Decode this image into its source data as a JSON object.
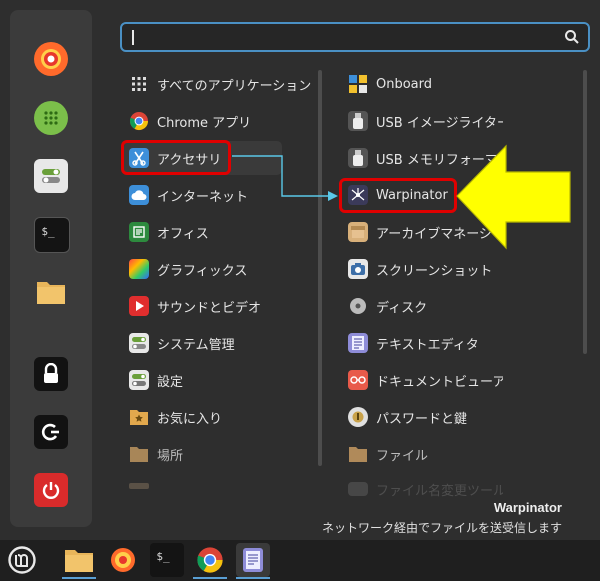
{
  "search": {
    "value": ""
  },
  "favorites": [
    "firefox",
    "calculator",
    "settings",
    "terminal",
    "files",
    "lock",
    "logout",
    "shutdown"
  ],
  "categories": [
    {
      "label": "すべてのアプリケーション",
      "icon": "grid-icon"
    },
    {
      "label": "Chrome アプリ",
      "icon": "chrome-icon"
    },
    {
      "label": "アクセサリ",
      "icon": "scissors-icon"
    },
    {
      "label": "インターネット",
      "icon": "cloud-icon"
    },
    {
      "label": "オフィス",
      "icon": "office-icon"
    },
    {
      "label": "グラフィックス",
      "icon": "graphics-icon"
    },
    {
      "label": "サウンドとビデオ",
      "icon": "play-icon"
    },
    {
      "label": "システム管理",
      "icon": "toggle-icon"
    },
    {
      "label": "設定",
      "icon": "settings-icon"
    },
    {
      "label": "お気に入り",
      "icon": "star-folder-icon"
    },
    {
      "label": "場所",
      "icon": "folder-icon"
    }
  ],
  "apps": [
    {
      "label": "Onboard",
      "icon": "onboard-icon"
    },
    {
      "label": "USB イメージライター",
      "icon": "usb-icon"
    },
    {
      "label": "USB メモリフォーマッタ",
      "icon": "usb-icon"
    },
    {
      "label": "Warpinator",
      "icon": "warpinator-icon"
    },
    {
      "label": "アーカイブマネージャー",
      "icon": "archive-icon"
    },
    {
      "label": "スクリーンショット",
      "icon": "camera-icon"
    },
    {
      "label": "ディスク",
      "icon": "disk-icon"
    },
    {
      "label": "テキストエディタ",
      "icon": "text-editor-icon"
    },
    {
      "label": "ドキュメントビューアー",
      "icon": "document-viewer-icon"
    },
    {
      "label": "パスワードと鍵",
      "icon": "keys-icon"
    },
    {
      "label": "ファイル",
      "icon": "folder-icon"
    },
    {
      "label": "ファイル名変更ツール",
      "icon": "rename-icon"
    }
  ],
  "description": {
    "title": "Warpinator",
    "text": "ネットワーク経由でファイルを送受信します"
  },
  "taskbar": [
    "mint-menu",
    "files",
    "firefox",
    "terminal",
    "chrome",
    "text-editor"
  ],
  "colors": {
    "highlight": "#e00000",
    "arrow": "#ffff00",
    "connector": "#5ac8e8",
    "accent": "#4a90c4"
  }
}
